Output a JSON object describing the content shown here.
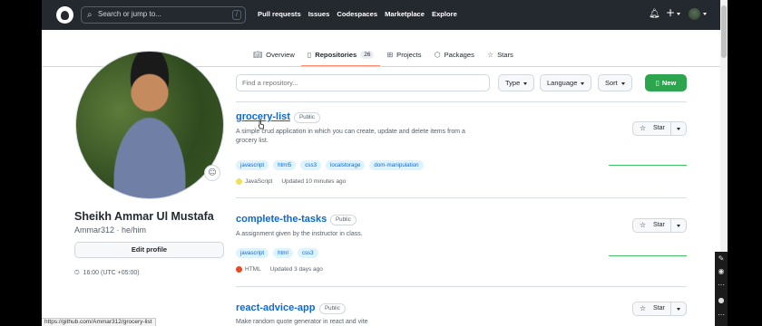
{
  "header": {
    "search_placeholder": "Search or jump to...",
    "search_shortcut": "/",
    "nav": [
      "Pull requests",
      "Issues",
      "Codespaces",
      "Marketplace",
      "Explore"
    ],
    "plus_label": "+"
  },
  "tabs": [
    {
      "label": "Overview",
      "icon": "book-icon"
    },
    {
      "label": "Repositories",
      "icon": "repo-icon",
      "count": "26",
      "active": true
    },
    {
      "label": "Projects",
      "icon": "table-icon"
    },
    {
      "label": "Packages",
      "icon": "package-icon"
    },
    {
      "label": "Stars",
      "icon": "star-icon"
    }
  ],
  "profile": {
    "name": "Sheikh Ammar Ul Mustafa",
    "handle": "Ammar312 · he/him",
    "edit_label": "Edit profile",
    "time": "16:00 (UTC +05:00)"
  },
  "filters": {
    "find_placeholder": "Find a repository...",
    "type_label": "Type",
    "language_label": "Language",
    "sort_label": "Sort",
    "new_label": "New"
  },
  "repos": [
    {
      "name": "grocery-list",
      "visibility": "Public",
      "description": "A simple crud application in which you can create, update and delete items from a grocery list.",
      "topics": [
        "javascript",
        "html5",
        "css3",
        "localstorage",
        "dom-manipulation"
      ],
      "language": "JavaScript",
      "language_color": "#f1e05a",
      "updated": "Updated 10 minutes ago",
      "star_label": "Star"
    },
    {
      "name": "complete-the-tasks",
      "visibility": "Public",
      "description": "A assignment given by the instructor in class.",
      "topics": [
        "javascript",
        "html",
        "css3"
      ],
      "language": "HTML",
      "language_color": "#e34c26",
      "updated": "Updated 3 days ago",
      "star_label": "Star"
    },
    {
      "name": "react-advice-app",
      "visibility": "Public",
      "description": "Make random quote generator in react and vite",
      "star_label": "Star"
    }
  ],
  "status_url": "https://github.com/Ammar312/grocery-list",
  "colors": {
    "header_bg": "#24292f",
    "link": "#0969da",
    "new_button": "#2da44e",
    "tab_underline": "#fd8c73"
  }
}
